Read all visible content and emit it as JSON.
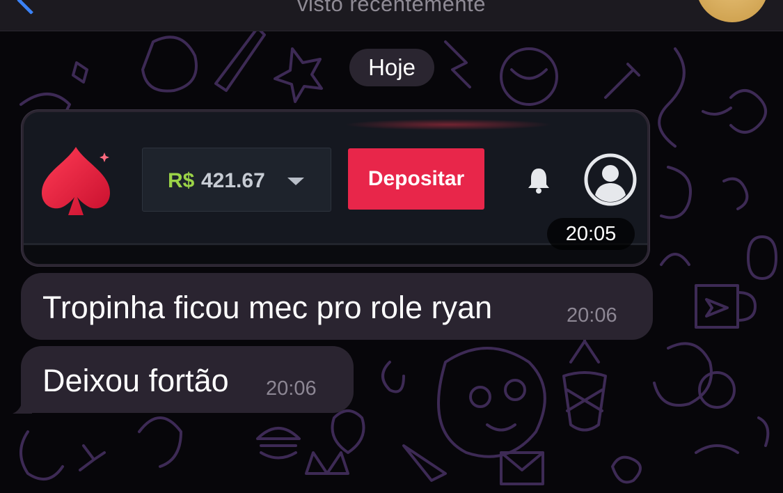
{
  "header": {
    "status": "visto recentemente"
  },
  "chat": {
    "date_label": "Hoje",
    "image_message": {
      "time": "20:05",
      "screenshot": {
        "logo_icon": "spade-icon",
        "balance_currency": "R$",
        "balance_amount": "421.67",
        "deposit_label": "Depositar",
        "bell_icon": "bell-icon",
        "profile_icon": "user-avatar-icon",
        "colors": {
          "accent": "#e8264a",
          "currency": "#9bd347",
          "panel": "#151820"
        }
      }
    },
    "messages": [
      {
        "text": "Tropinha ficou mec pro role ryan",
        "time": "20:06"
      },
      {
        "text": "Deixou fortão",
        "time": "20:06"
      }
    ]
  },
  "colors": {
    "bubble": "#2a2430",
    "background": "#07060a",
    "link": "#3b82f6"
  }
}
